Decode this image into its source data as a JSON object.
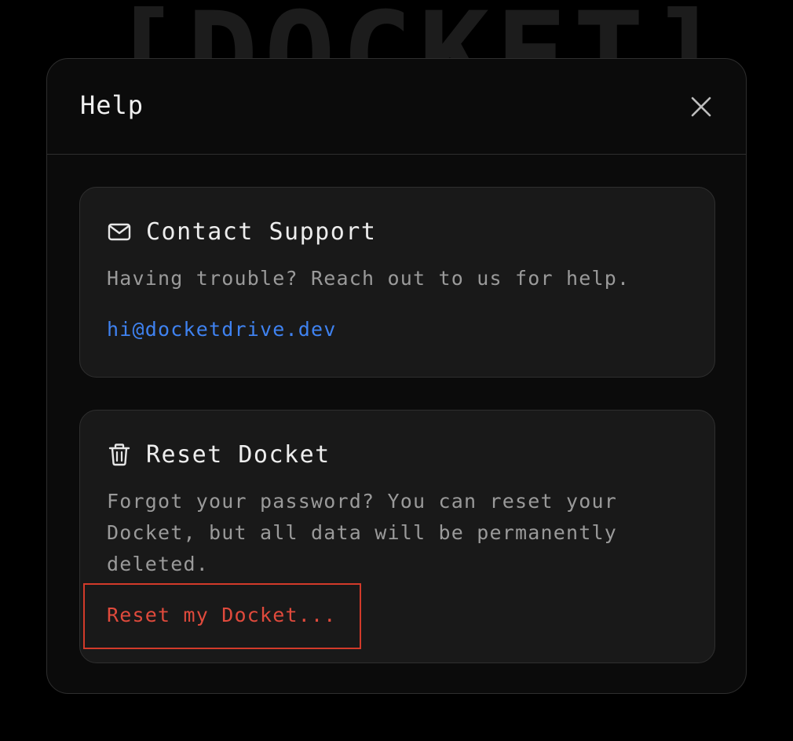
{
  "background": {
    "logo_text": "[DOCKET]"
  },
  "dialog": {
    "title": "Help",
    "close_icon": "close-icon"
  },
  "support": {
    "icon": "mail-icon",
    "title": "Contact Support",
    "description": "Having trouble? Reach out to us for help.",
    "email": "hi@docketdrive.dev"
  },
  "reset": {
    "icon": "trash-icon",
    "title": "Reset Docket",
    "description": "Forgot your password? You can reset your Docket, but all data will be permanently deleted.",
    "action_label": "Reset my Docket..."
  },
  "colors": {
    "link": "#3f82f0",
    "danger": "#e04a3c",
    "highlight_border": "#d23a2a"
  }
}
